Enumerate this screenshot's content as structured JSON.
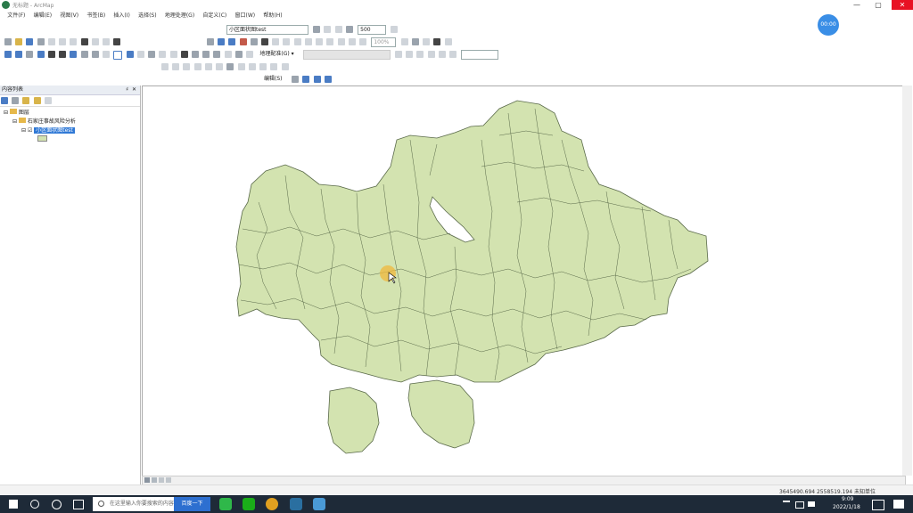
{
  "window": {
    "title": "无标题 - ArcMap",
    "min_glyph": "—",
    "max_glyph": "▢",
    "close_glyph": "✕"
  },
  "menu": [
    "文件(F)",
    "编辑(E)",
    "视图(V)",
    "书签(B)",
    "插入(I)",
    "选择(S)",
    "地理处理(G)",
    "自定义(C)",
    "窗口(W)",
    "帮助(H)"
  ],
  "toolbar": {
    "layer_select": "小区面状图test",
    "scale_value": "500",
    "zoom_value": "100%",
    "georef_label": "地理配准(G) ▾",
    "edit_label": "编辑(S) ▾"
  },
  "toc": {
    "title": "内容列表",
    "pin_glyph": "♯",
    "close_glyph": "✕",
    "root": "图层",
    "group": "石家庄事故风险分析",
    "layer": "小区面状图test",
    "expand_glyph": "⊟",
    "check_glyph": "☑"
  },
  "status": {
    "coords": "3645490.694   2558519.194 未知单位"
  },
  "taskbar": {
    "search_placeholder": "在这里输入你要搜索的内容",
    "search_button": "百度一下",
    "time": "9:09",
    "date": "2022/1/18"
  },
  "overlay": {
    "avatar_text": "00:00"
  },
  "colors": {
    "map_fill": "#d3e3b0",
    "map_stroke": "#5a6a4a",
    "cursor_highlight": "#f0b83c",
    "taskbar_bg": "#1e2a38",
    "selection_blue": "#3079d6"
  }
}
